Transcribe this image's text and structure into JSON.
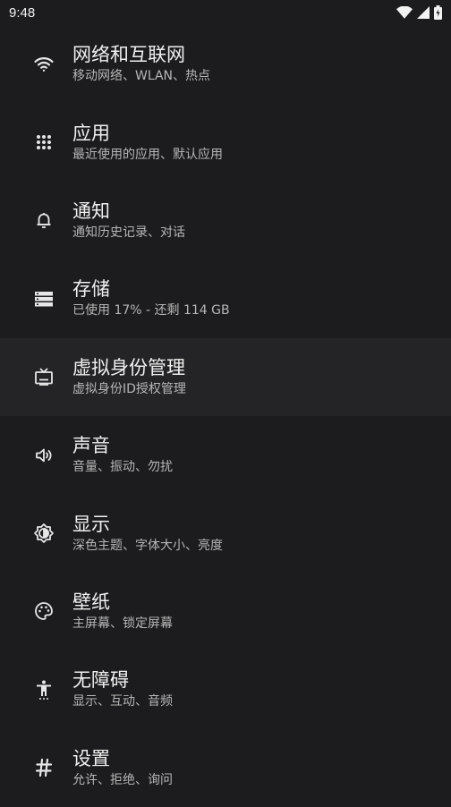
{
  "status": {
    "time": "9:48"
  },
  "items": [
    {
      "icon": "wifi-icon",
      "title": "网络和互联网",
      "subtitle": "移动网络、WLAN、热点"
    },
    {
      "icon": "apps-grid-icon",
      "title": "应用",
      "subtitle": "最近使用的应用、默认应用"
    },
    {
      "icon": "bell-icon",
      "title": "通知",
      "subtitle": "通知历史记录、对话"
    },
    {
      "icon": "storage-icon",
      "title": "存储",
      "subtitle": "已使用 17% - 还剩 114 GB"
    },
    {
      "icon": "tv-icon",
      "title": "虚拟身份管理",
      "subtitle": "虚拟身份ID授权管理"
    },
    {
      "icon": "speaker-icon",
      "title": "声音",
      "subtitle": "音量、振动、勿扰"
    },
    {
      "icon": "brightness-icon",
      "title": "显示",
      "subtitle": "深色主题、字体大小、亮度"
    },
    {
      "icon": "palette-icon",
      "title": "壁纸",
      "subtitle": "主屏幕、锁定屏幕"
    },
    {
      "icon": "accessibility-icon",
      "title": "无障碍",
      "subtitle": "显示、互动、音频"
    },
    {
      "icon": "hash-icon",
      "title": "设置",
      "subtitle": "允许、拒绝、询问"
    }
  ]
}
